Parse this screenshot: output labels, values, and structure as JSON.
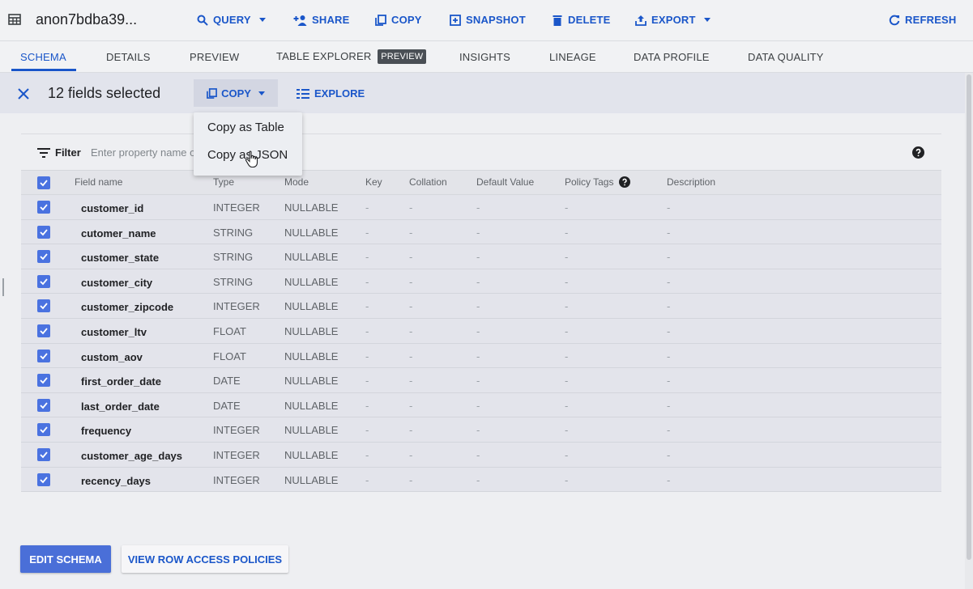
{
  "toolbar": {
    "title": "anon7bdba39...",
    "buttons": {
      "query": "QUERY",
      "share": "SHARE",
      "copy": "COPY",
      "snapshot": "SNAPSHOT",
      "delete": "DELETE",
      "export": "EXPORT",
      "refresh": "REFRESH"
    }
  },
  "tabs": {
    "schema": "SCHEMA",
    "details": "DETAILS",
    "preview": "PREVIEW",
    "table_explorer": "TABLE EXPLORER",
    "table_explorer_badge": "PREVIEW",
    "insights": "INSIGHTS",
    "lineage": "LINEAGE",
    "data_profile": "DATA PROFILE",
    "data_quality": "DATA QUALITY",
    "active": "SCHEMA"
  },
  "selection": {
    "text": "12 fields selected",
    "copy_label": "COPY",
    "explore_label": "EXPLORE"
  },
  "copy_menu": {
    "items": [
      "Copy as Table",
      "Copy as JSON"
    ]
  },
  "filter": {
    "label": "Filter",
    "placeholder": "Enter property name or value"
  },
  "table": {
    "headers": {
      "field_name": "Field name",
      "type": "Type",
      "mode": "Mode",
      "key": "Key",
      "collation": "Collation",
      "default_value": "Default Value",
      "policy_tags": "Policy Tags",
      "description": "Description"
    },
    "rows": [
      {
        "name": "customer_id",
        "type": "INTEGER",
        "mode": "NULLABLE",
        "key": "-",
        "collation": "-",
        "default": "-",
        "policy": "-",
        "description": "-"
      },
      {
        "name": "cutomer_name",
        "type": "STRING",
        "mode": "NULLABLE",
        "key": "-",
        "collation": "-",
        "default": "-",
        "policy": "-",
        "description": "-"
      },
      {
        "name": "customer_state",
        "type": "STRING",
        "mode": "NULLABLE",
        "key": "-",
        "collation": "-",
        "default": "-",
        "policy": "-",
        "description": "-"
      },
      {
        "name": "customer_city",
        "type": "STRING",
        "mode": "NULLABLE",
        "key": "-",
        "collation": "-",
        "default": "-",
        "policy": "-",
        "description": "-"
      },
      {
        "name": "customer_zipcode",
        "type": "INTEGER",
        "mode": "NULLABLE",
        "key": "-",
        "collation": "-",
        "default": "-",
        "policy": "-",
        "description": "-"
      },
      {
        "name": "customer_ltv",
        "type": "FLOAT",
        "mode": "NULLABLE",
        "key": "-",
        "collation": "-",
        "default": "-",
        "policy": "-",
        "description": "-"
      },
      {
        "name": "custom_aov",
        "type": "FLOAT",
        "mode": "NULLABLE",
        "key": "-",
        "collation": "-",
        "default": "-",
        "policy": "-",
        "description": "-"
      },
      {
        "name": "first_order_date",
        "type": "DATE",
        "mode": "NULLABLE",
        "key": "-",
        "collation": "-",
        "default": "-",
        "policy": "-",
        "description": "-"
      },
      {
        "name": "last_order_date",
        "type": "DATE",
        "mode": "NULLABLE",
        "key": "-",
        "collation": "-",
        "default": "-",
        "policy": "-",
        "description": "-"
      },
      {
        "name": "frequency",
        "type": "INTEGER",
        "mode": "NULLABLE",
        "key": "-",
        "collation": "-",
        "default": "-",
        "policy": "-",
        "description": "-"
      },
      {
        "name": "customer_age_days",
        "type": "INTEGER",
        "mode": "NULLABLE",
        "key": "-",
        "collation": "-",
        "default": "-",
        "policy": "-",
        "description": "-"
      },
      {
        "name": "recency_days",
        "type": "INTEGER",
        "mode": "NULLABLE",
        "key": "-",
        "collation": "-",
        "default": "-",
        "policy": "-",
        "description": "-"
      }
    ]
  },
  "footer": {
    "edit_schema": "EDIT SCHEMA",
    "view_row_access": "VIEW ROW ACCESS POLICIES"
  },
  "colors": {
    "accent": "#1a56c9",
    "checkbox": "#4a72e0",
    "primary_button": "#4a6fd8"
  },
  "icons": {
    "table": "table-icon",
    "query": "search-icon",
    "share": "person-add-icon",
    "copy": "copy-icon",
    "snapshot": "snapshot-icon",
    "delete": "trash-icon",
    "export": "upload-icon",
    "refresh": "refresh-icon",
    "close": "close-icon",
    "explore": "explore-icon",
    "filter": "filter-icon",
    "help": "help-icon",
    "cursor": "hand-cursor-icon"
  }
}
